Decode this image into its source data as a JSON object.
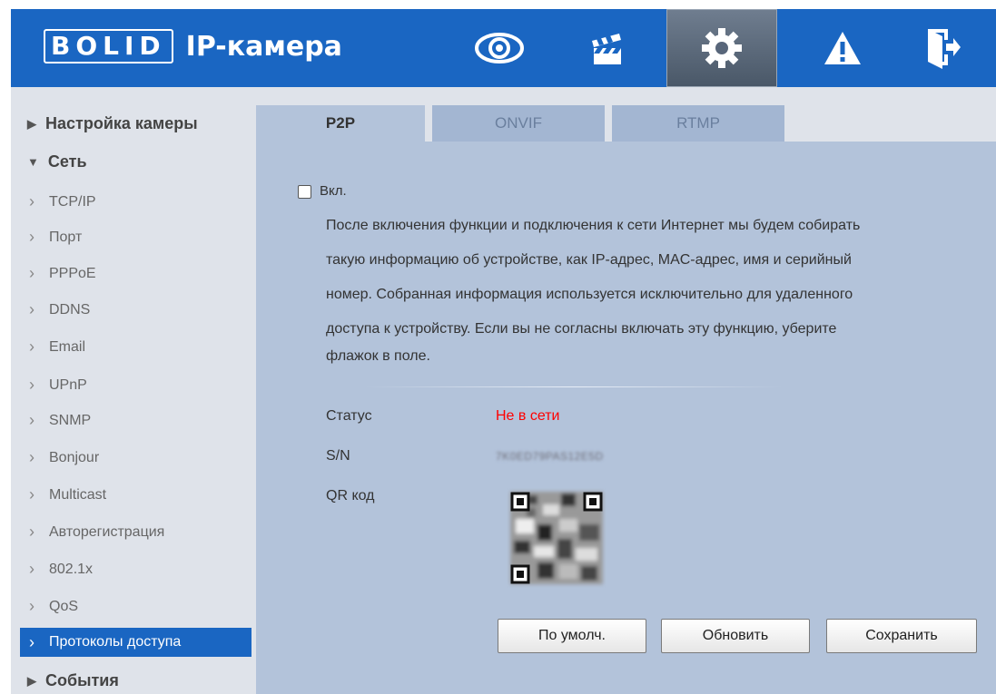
{
  "header": {
    "logo_text": "BOLID",
    "app_title": "IP-камера",
    "nav": [
      {
        "name": "live-view",
        "icon": "eye-icon"
      },
      {
        "name": "playback",
        "icon": "clapperboard-icon"
      },
      {
        "name": "settings",
        "icon": "gear-icon"
      },
      {
        "name": "alarm",
        "icon": "warning-icon"
      },
      {
        "name": "logout",
        "icon": "exit-door-icon"
      }
    ]
  },
  "sidebar": {
    "groups": {
      "camera": "Настройка камеры",
      "network": "Сеть",
      "events": "События"
    },
    "items": [
      "TCP/IP",
      "Порт",
      "PPPoE",
      "DDNS",
      "Email",
      "UPnP",
      "SNMP",
      "Bonjour",
      "Multicast",
      "Авторегистрация",
      "802.1x",
      "QoS",
      "Протоколы доступа"
    ]
  },
  "tabs": [
    "P2P",
    "ONVIF",
    "RTMP"
  ],
  "p2p": {
    "enable_label": "Вкл.",
    "enabled": false,
    "notice_lines": [
      "После включения функции и подключения к сети Интернет мы будем собирать",
      "такую информацию об устройстве, как IP-адрес, MAC-адрес, имя и серийный",
      "номер. Собранная информация используется исключительно для удаленного",
      "доступа к устройству. Если вы не согласны включать эту функцию, уберите",
      "флажок в поле."
    ],
    "status_label": "Статус",
    "status_value": "Не в сети",
    "sn_label": "S/N",
    "sn_value": "7K0ED79PAS12E5D",
    "qr_label": "QR код"
  },
  "buttons": {
    "default": "По умолч.",
    "refresh": "Обновить",
    "save": "Сохранить"
  },
  "colors": {
    "header_bg": "#1a66c2",
    "status_offline": "#ff0000",
    "active_item_bg": "#1a66c2"
  }
}
